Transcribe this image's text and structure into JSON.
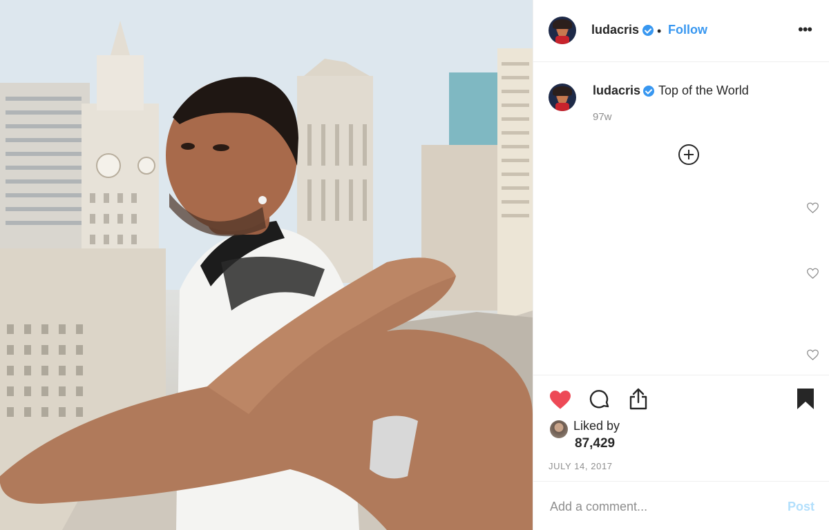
{
  "post": {
    "image_alt": "Man reaching toward the camera on a rooftop above city skyscrapers"
  },
  "header": {
    "username": "ludacris",
    "separator": "•",
    "follow_label": "Follow",
    "more_label": "•••"
  },
  "caption": {
    "username": "ludacris",
    "text": "Top of the World",
    "time_ago": "97w"
  },
  "actions": {
    "liked": true,
    "saved": true,
    "like_color": "#ed4956"
  },
  "likes": {
    "label": "Liked by",
    "count": "87,429"
  },
  "date": "JULY 14, 2017",
  "comment": {
    "placeholder": "Add a comment...",
    "post_label": "Post"
  },
  "colors": {
    "accent": "#3897f0",
    "post_disabled": "#b2dffc",
    "muted": "#8e8e8e"
  }
}
